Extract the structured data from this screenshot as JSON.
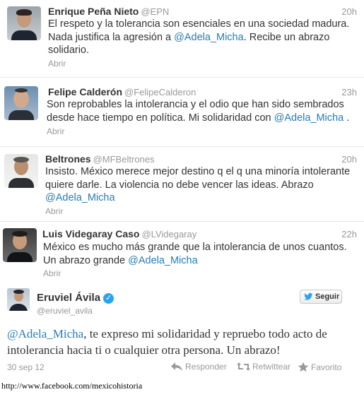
{
  "tweets": [
    {
      "name": "Enrique Peña Nieto",
      "handle": "@EPN",
      "time": "20h",
      "text_before": "El respeto y la tolerancia son esenciales en una sociedad madura. Nada justifica la agresión a ",
      "mention": "@Adela_Micha",
      "text_after": ". Recibe un abrazo solidario.",
      "action": "Abrir"
    },
    {
      "name": "Felipe Calderón",
      "handle": "@FelipeCalderon",
      "time": "23h",
      "text_before": "Son reprobables la intolerancia y el odio que han sido sembrados desde hace tiempo en política. Mi solidaridad con ",
      "mention": "@Adela_Micha",
      "text_after": " .",
      "action": "Abrir"
    },
    {
      "name": "Beltrones",
      "handle": "@MFBeltrones",
      "time": "20h",
      "text_before": "Insisto. México merece mejor destino q el q una minoría intolerante quiere darle. La violencia no debe vencer las ideas. Abrazo ",
      "mention": "@Adela_Micha",
      "text_after": "",
      "action": "Abrir"
    },
    {
      "name": "Luis Videgaray Caso",
      "handle": "@LVidegaray",
      "time": "22h",
      "text_before": "México es mucho más grande que la intolerancia de unos cuantos. Un abrazo grande ",
      "mention": "@Adela_Micha",
      "text_after": "",
      "action": "Abrir"
    }
  ],
  "embedded": {
    "name": "Eruviel Ávila",
    "handle": "@eruviel_avila",
    "follow_label": "Seguir",
    "mention": "@Adela_Micha",
    "text_after": ", te expreso mi solidaridad y repruebo todo acto de intolerancia hacia ti o cualquier otra persona. Un abrazo!",
    "date": "30 sep 12",
    "reply_label": "Responder",
    "retweet_label": "Retwittear",
    "favorite_label": "Favorito",
    "icons": [
      "verified-icon",
      "bird-icon",
      "reply-icon",
      "retweet-icon",
      "star-icon"
    ]
  },
  "source_url": "http://www.facebook.com/mexicohistoria",
  "colors": {
    "mention": "#2a7bb3",
    "muted": "#999999",
    "text": "#333333",
    "verified": "#2aa3ef"
  }
}
